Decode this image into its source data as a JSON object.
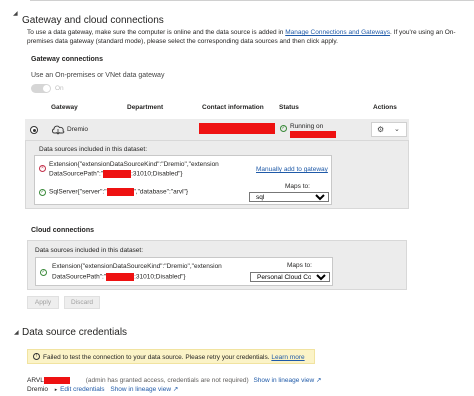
{
  "header": {
    "title": "Gateway and cloud connections",
    "intro_part1": "To use a data gateway, make sure the computer is online and the data source is added in ",
    "intro_link": "Manage Connections and Gateways",
    "intro_part2": ". If you're using an On-premises data gateway (standard mode), please select the corresponding data sources and then click apply."
  },
  "gateway_connections": {
    "title": "Gateway connections",
    "toggle_label": "Use an On-premises or VNet data gateway",
    "toggle_state": "On",
    "columns": [
      "Gateway",
      "Department",
      "Contact information",
      "Status",
      "Actions"
    ],
    "row": {
      "gateway_name": "Dremio",
      "status": "Running on"
    },
    "datasources_title": "Data sources included in this dataset:",
    "datasources": [
      {
        "text_line1": "Extension{\"extensionDataSourceKind\":\"Dremio\",\"extension",
        "text_line2_prefix": "DataSourcePath\":\"",
        "text_line2_suffix": ":31010;Disabled\"}",
        "action": "Manually add to gateway"
      },
      {
        "text_prefix": "SqlServer{\"server\":\"",
        "text_suffix": "\",\"database\":\"arvl\"}",
        "maps_label": "Maps to:",
        "maps_value": "sql"
      }
    ]
  },
  "cloud_connections": {
    "title": "Cloud connections",
    "datasources_title": "Data sources included in this dataset:",
    "datasource": {
      "text_line1": "Extension{\"extensionDataSourceKind\":\"Dremio\",\"extension",
      "text_line2_prefix": "DataSourcePath\":\"",
      "text_line2_suffix": ":31010;Disabled\"}",
      "maps_label": "Maps to:",
      "maps_value": "Personal Cloud Connect"
    }
  },
  "buttons": {
    "apply": "Apply",
    "discard": "Discard"
  },
  "credentials": {
    "title": "Data source credentials",
    "warning_text": "Failed to test the connection to your data source. Please retry your credentials.",
    "warning_link": "Learn more",
    "items": [
      {
        "name": "ARVL",
        "note": "(admin has granted access, credentials are not required)",
        "link": "Show in lineage view"
      },
      {
        "name": "Dremio",
        "edit": "Edit credentials",
        "link": "Show in lineage view"
      }
    ]
  },
  "colors": {
    "redaction": "#ee1111",
    "link": "#1f5aa8",
    "warning_bg": "#fbf3c7",
    "success": "#3b8a3b",
    "error": "#c4314b"
  }
}
